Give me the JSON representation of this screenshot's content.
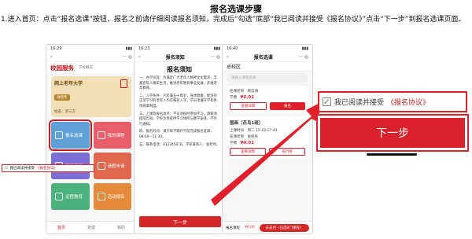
{
  "doc": {
    "title": "报名选课步骤",
    "paragraph": "1.进入首页：点击“报名选课”按钮，报名之前请仔细阅读报名须知，完成后“勾选”底部“我已阅读并接受《报名协议》”点击“下一步”到报名选课页面。"
  },
  "phone1": {
    "status_time": "16:29",
    "title": "校园服务",
    "subtitle": "学校概况",
    "school": "网上老年大学",
    "tag": "讲授专",
    "student": "姓名：李三方",
    "tiles": [
      {
        "label": "报名选课",
        "color": "#5fa0d8"
      },
      {
        "label": "我的课程",
        "color": "#e85d6a"
      },
      {
        "label": "网络课程",
        "color": "#7b6fd4"
      },
      {
        "label": "请假申请",
        "color": "#e0684f"
      },
      {
        "label": "远程教育",
        "color": "#4ab27a"
      },
      {
        "label": "活动报名",
        "color": "#e58a3a"
      }
    ],
    "tabs": [
      "首页",
      "党建",
      "我的"
    ]
  },
  "phone2": {
    "status_time": "16:23",
    "appbar_title": "报名须知",
    "heading": "报名须知",
    "paragraphs": [
      "一、办学宗旨：为满足广大老年人精神文化需求，丰富老年人晚年生活，推进老年教育事业发展，开展老年教育。",
      "二、入学条件：凡年满五十周岁，身体健康，能坚持正常学习的老年人均可报名入学。学员须遵守学校各项规章制度。",
      "三、上课及报名地点：学员须按时参加学习，请假须提前告知。学校负责提供学习场所与教学安排，不另行通知。",
      "四、报名时间：请于每学期开学前完成报名选课，08:00—11:30。",
      "五、联系电话：012345678，学校联系人：张老师。"
    ],
    "agree_prefix": "我已阅读并接受",
    "agree_link": "《报名协议》",
    "next": "下一步"
  },
  "phone3": {
    "status_time": "16:40",
    "appbar_title": "报名选课",
    "region": "总校区",
    "search_placeholder": "请输入课程名称",
    "course1": {
      "teacher_label": "任课老师",
      "teacher": "杨云海",
      "fee_label": "学费",
      "price": "¥0.01",
      "btn_detail": "查看详情",
      "btn_signup": "报名"
    },
    "course2": {
      "title": "国画（花鸟1班）",
      "time_label": "上课时间",
      "time": "周二 15:43-17:44",
      "teacher_label": "任课老师",
      "teacher": "张经英",
      "fee_label": "学费",
      "price": "¥0.01",
      "btn_detail": "查看详情",
      "btn_waitlist": "排行榜"
    },
    "bottom_left": "报名课程",
    "bottom_price": "¥0.00",
    "bottom_pay": "去支付（已选0门课程）"
  },
  "callout": {
    "agree_prefix": "我已阅读并接受",
    "agree_link": "《报名协议》",
    "next": "下一步"
  },
  "colors": {
    "accent_red": "#d32626",
    "check_green": "#35a83a"
  }
}
